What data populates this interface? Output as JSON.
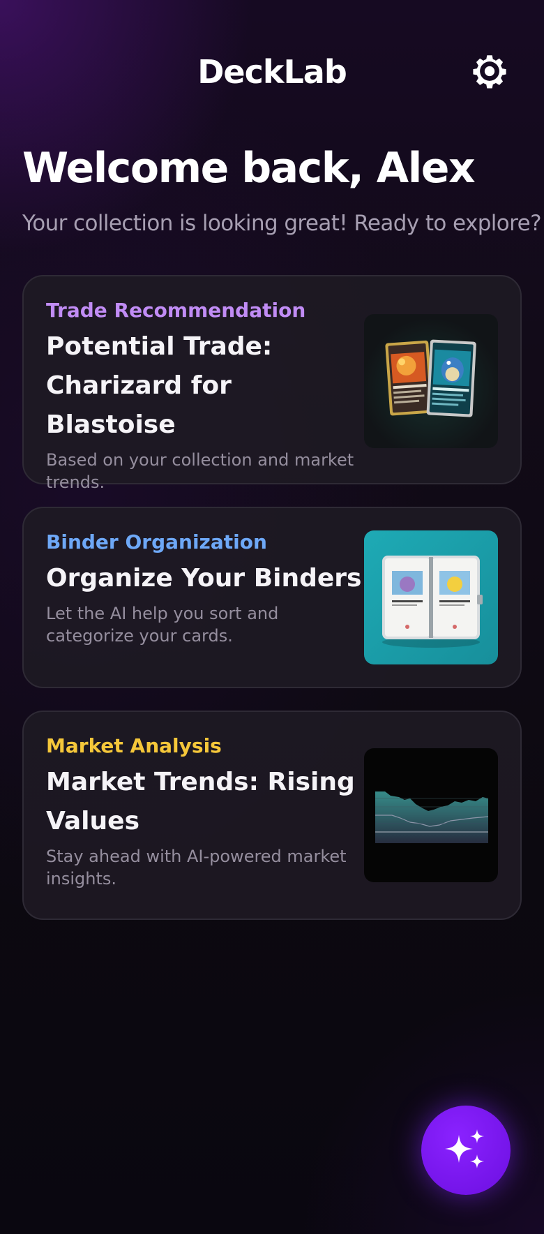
{
  "header": {
    "app_title": "DeckLab",
    "settings_icon": "gear-icon"
  },
  "welcome": {
    "heading": "Welcome back, Alex",
    "subtitle": "Your collection is looking great! Ready to explore?"
  },
  "cards": [
    {
      "label": "Trade Recommendation",
      "label_color": "#c18cf5",
      "title": "Potential Trade: Charizard for Blastoise",
      "description": "Based on your collection and market trends.",
      "image": "trade-cards-image"
    },
    {
      "label": "Binder Organization",
      "label_color": "#6ea8f7",
      "title": "Organize Your Binders",
      "description": "Let the AI help you sort and categorize your cards.",
      "image": "binder-image"
    },
    {
      "label": "Market Analysis",
      "label_color": "#f5c73a",
      "title": "Market Trends: Rising Values",
      "description": "Stay ahead with AI-powered market insights.",
      "image": "market-chart-image"
    }
  ],
  "fab": {
    "icon": "sparkles-icon",
    "color": "#7c14f5"
  }
}
